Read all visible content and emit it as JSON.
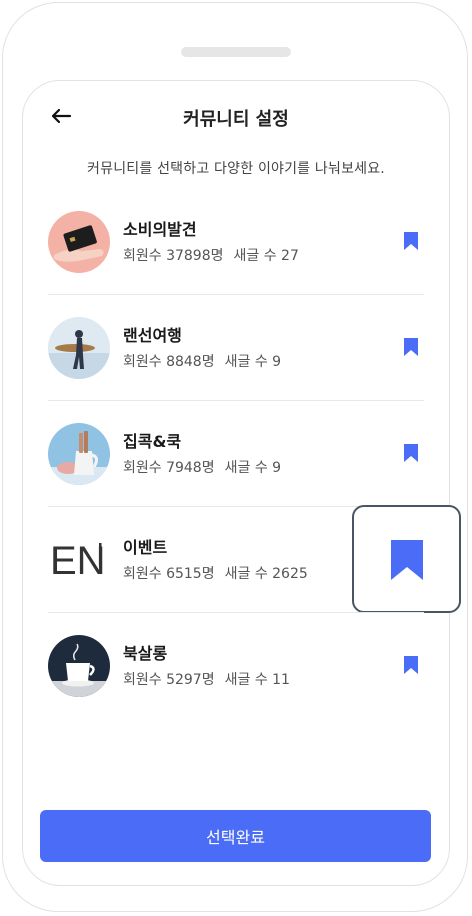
{
  "header": {
    "title": "커뮤니티 설정",
    "subtitle": "커뮤니티를 선택하고 다양한 이야기를 나눠보세요."
  },
  "communities": [
    {
      "name": "소비의발견",
      "members": "회원수 37898명",
      "posts": "새글 수 27",
      "bookmarked": true
    },
    {
      "name": "랜선여행",
      "members": "회원수 8848명",
      "posts": "새글 수 9",
      "bookmarked": true
    },
    {
      "name": "집콕&쿡",
      "members": "회원수 7948명",
      "posts": "새글 수 9",
      "bookmarked": true
    },
    {
      "name": "이벤트",
      "members": "회원수 6515명",
      "posts": "새글 수 2625",
      "bookmarked": true,
      "avatar_text": "EN"
    },
    {
      "name": "북살롱",
      "members": "회원수 5297명",
      "posts": "새글 수 11",
      "bookmarked": true
    }
  ],
  "footer": {
    "complete_label": "선택완료"
  },
  "colors": {
    "accent": "#4a6cf7"
  }
}
